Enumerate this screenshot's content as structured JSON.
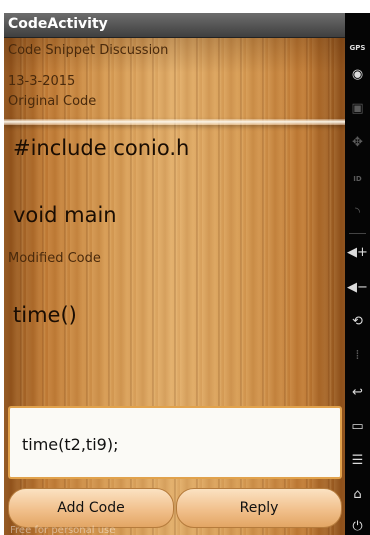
{
  "app": {
    "title": "CodeActivity"
  },
  "content": {
    "heading": "Code Snippet Discussion",
    "date": "13-3-2015",
    "original_label": "Original Code",
    "original_lines": [
      "#include conio.h",
      "void main"
    ],
    "modified_label": "Modified Code",
    "modified_lines": [
      "time()"
    ]
  },
  "editor": {
    "value": "time(t2,ti9);"
  },
  "buttons": {
    "add_code": "Add Code",
    "reply": "Reply"
  },
  "watermark": "Free for personal use",
  "side_controls": [
    {
      "name": "gps-icon",
      "glyph": "GPS"
    },
    {
      "name": "camera-icon",
      "glyph": "◉"
    },
    {
      "name": "media-icon",
      "glyph": "▣"
    },
    {
      "name": "dpad-icon",
      "glyph": "✥"
    },
    {
      "name": "id-icon",
      "glyph": "ID"
    },
    {
      "name": "rss-icon",
      "glyph": "◝"
    },
    {
      "name": "volume-up-icon",
      "glyph": "◀+"
    },
    {
      "name": "volume-down-icon",
      "glyph": "◀−"
    },
    {
      "name": "rotate-icon",
      "glyph": "⟲"
    },
    {
      "name": "scale-icon",
      "glyph": "⁞"
    },
    {
      "name": "back-icon",
      "glyph": "↩"
    },
    {
      "name": "recent-apps-icon",
      "glyph": "▭"
    },
    {
      "name": "menu-icon",
      "glyph": "☰"
    },
    {
      "name": "home-icon",
      "glyph": "⌂"
    },
    {
      "name": "power-icon",
      "glyph": "⏻"
    }
  ]
}
